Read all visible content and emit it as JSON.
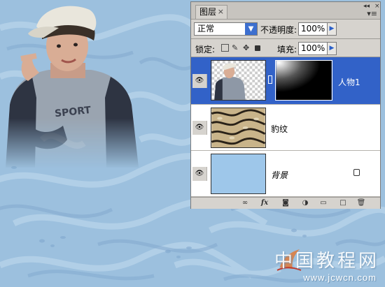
{
  "panel": {
    "tab_label": "图层",
    "tab_close": "×",
    "pin_icon": "collapse-arrows-icon",
    "menu_icon": "panel-menu-icon",
    "blend_mode": "正常",
    "opacity_label": "不透明度:",
    "opacity_value": "100%",
    "lock_label": "锁定:",
    "fill_label": "填充:",
    "fill_value": "100%"
  },
  "layers": [
    {
      "name": "人物1",
      "selected": true,
      "has_mask": true
    },
    {
      "name": "豹纹",
      "selected": false,
      "has_mask": false
    },
    {
      "name": "背景",
      "selected": false,
      "has_mask": false,
      "locked": true
    }
  ],
  "bottom_icons": [
    "link-layers-icon",
    "fx-icon",
    "add-mask-icon",
    "adjustment-layer-icon",
    "new-group-icon",
    "new-layer-icon",
    "trash-icon"
  ],
  "fx_label": "fx",
  "watermark": {
    "title": "中国教程网",
    "url": "www.jcwcn.com"
  },
  "colors": {
    "background": "#9cc0de",
    "panel": "#d6d3ce",
    "selection": "#3262c8",
    "background_layer_fill": "#9ec7ea"
  }
}
